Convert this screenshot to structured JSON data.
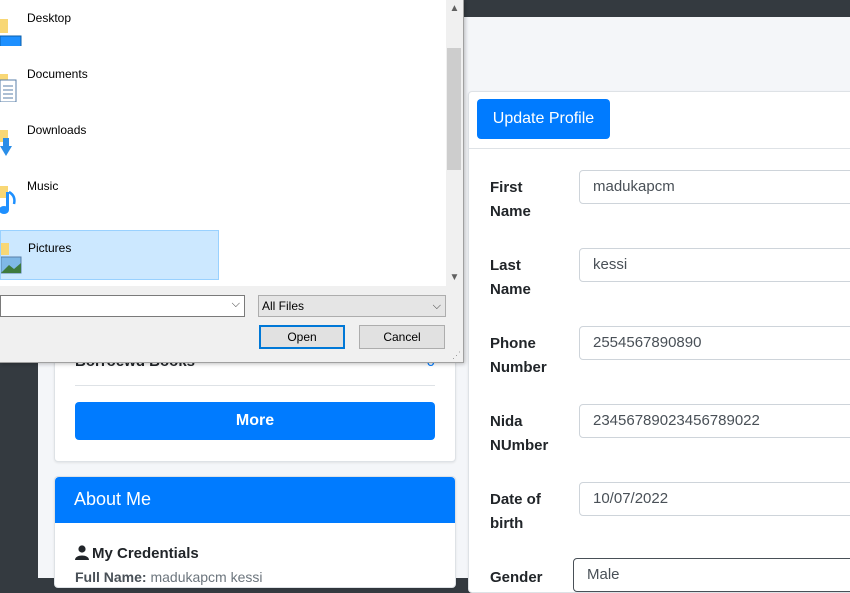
{
  "profile_form": {
    "update_button": "Update Profile",
    "fields": [
      {
        "label_line1": "First",
        "label_line2": "Name",
        "value": "madukapcm"
      },
      {
        "label_line1": "Last",
        "label_line2": "Name",
        "value": "kessi"
      },
      {
        "label_line1": "Phone",
        "label_line2": "Number",
        "value": "2554567890890"
      },
      {
        "label_line1": "Nida",
        "label_line2": "NUmber",
        "value": "23456789023456789022"
      },
      {
        "label_line1": "Date of",
        "label_line2": "birth",
        "value": "10/07/2022"
      }
    ],
    "gender": {
      "label": "Gender",
      "value": "Male"
    }
  },
  "stats": {
    "borrowed_label": "Borroewd Books",
    "borrowed_count": "0",
    "more_button": "More"
  },
  "about": {
    "title": "About Me",
    "credentials_title": "My Credentials",
    "full_name_label": "Full Name:",
    "full_name_value": "madukapcm kessi"
  },
  "file_dialog": {
    "items": [
      {
        "label": "Desktop",
        "icon": "desktop-folder-icon"
      },
      {
        "label": "Documents",
        "icon": "documents-folder-icon"
      },
      {
        "label": "Downloads",
        "icon": "downloads-folder-icon"
      },
      {
        "label": "Music",
        "icon": "music-folder-icon"
      },
      {
        "label": "Pictures",
        "icon": "pictures-folder-icon",
        "selected": true
      }
    ],
    "filename_value": "",
    "file_type_filter": "All Files",
    "open_button": "Open",
    "cancel_button": "Cancel"
  },
  "colors": {
    "primary": "#007bff",
    "sidebar": "#343a40",
    "content_bg": "#f4f6f9",
    "selection": "#cce8ff"
  }
}
